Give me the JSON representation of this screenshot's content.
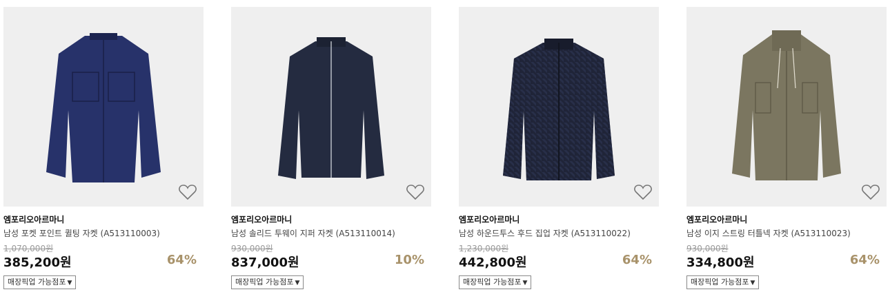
{
  "products": [
    {
      "brand": "엠포리오아르마니",
      "name": "남성 포켓 포인트 퀼팅 자켓 (A513110003)",
      "original_price": "1,070,000원",
      "price": "385,200원",
      "discount": "64%",
      "pickup_label": "매장픽업 가능점포",
      "jacket_color": "#27326a"
    },
    {
      "brand": "엠포리오아르마니",
      "name": "남성 솔리드 투웨이 지퍼 자켓 (A513110014)",
      "original_price": "930,000원",
      "price": "837,000원",
      "discount": "10%",
      "pickup_label": "매장픽업 가능점포",
      "jacket_color": "#242b40"
    },
    {
      "brand": "엠포리오아르마니",
      "name": "남성 하운드투스 후드 집업 자켓 (A513110022)",
      "original_price": "1,230,000원",
      "price": "442,800원",
      "discount": "64%",
      "pickup_label": "매장픽업 가능점포",
      "jacket_color": "#1f2438"
    },
    {
      "brand": "엠포리오아르마니",
      "name": "남성 이지 스트링 터틀넥 자켓 (A513110023)",
      "original_price": "930,000원",
      "price": "334,800원",
      "discount": "64%",
      "pickup_label": "매장픽업 가능점포",
      "jacket_color": "#7b7660"
    }
  ],
  "colors": {
    "discount": "#a8926a",
    "thumb_bg": "#efefef"
  },
  "icons": [
    "heart-icon",
    "dropdown-arrow-icon"
  ]
}
